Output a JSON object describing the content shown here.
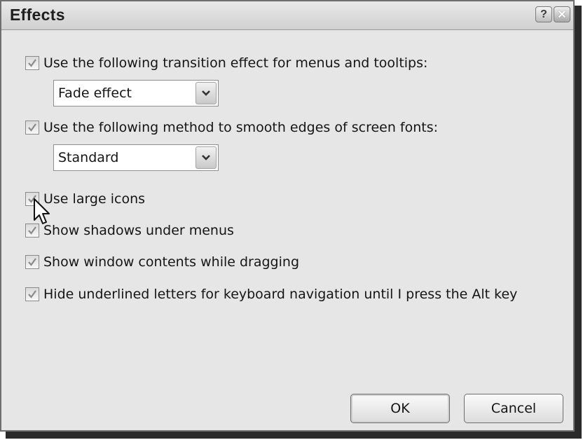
{
  "window": {
    "title": "Effects",
    "help_glyph": "?",
    "close_glyph": "✕"
  },
  "checkboxes": [
    {
      "label": "Use the following transition effect for menus and tooltips:",
      "checked": true
    },
    {
      "label": "Use the following method to smooth edges of screen fonts:",
      "checked": true
    },
    {
      "label": "Use large icons",
      "checked": true
    },
    {
      "label": "Show shadows under menus",
      "checked": true
    },
    {
      "label": "Show window contents while dragging",
      "checked": true
    },
    {
      "label": "Hide underlined letters for keyboard navigation until I press the Alt key",
      "checked": true
    }
  ],
  "dropdowns": [
    {
      "value": "Fade effect"
    },
    {
      "value": "Standard"
    }
  ],
  "buttons": {
    "ok": "OK",
    "cancel": "Cancel"
  },
  "icons": {
    "check": "checkmark-icon",
    "arrow": "chevron-down-icon",
    "cursor": "mouse-pointer-icon"
  }
}
